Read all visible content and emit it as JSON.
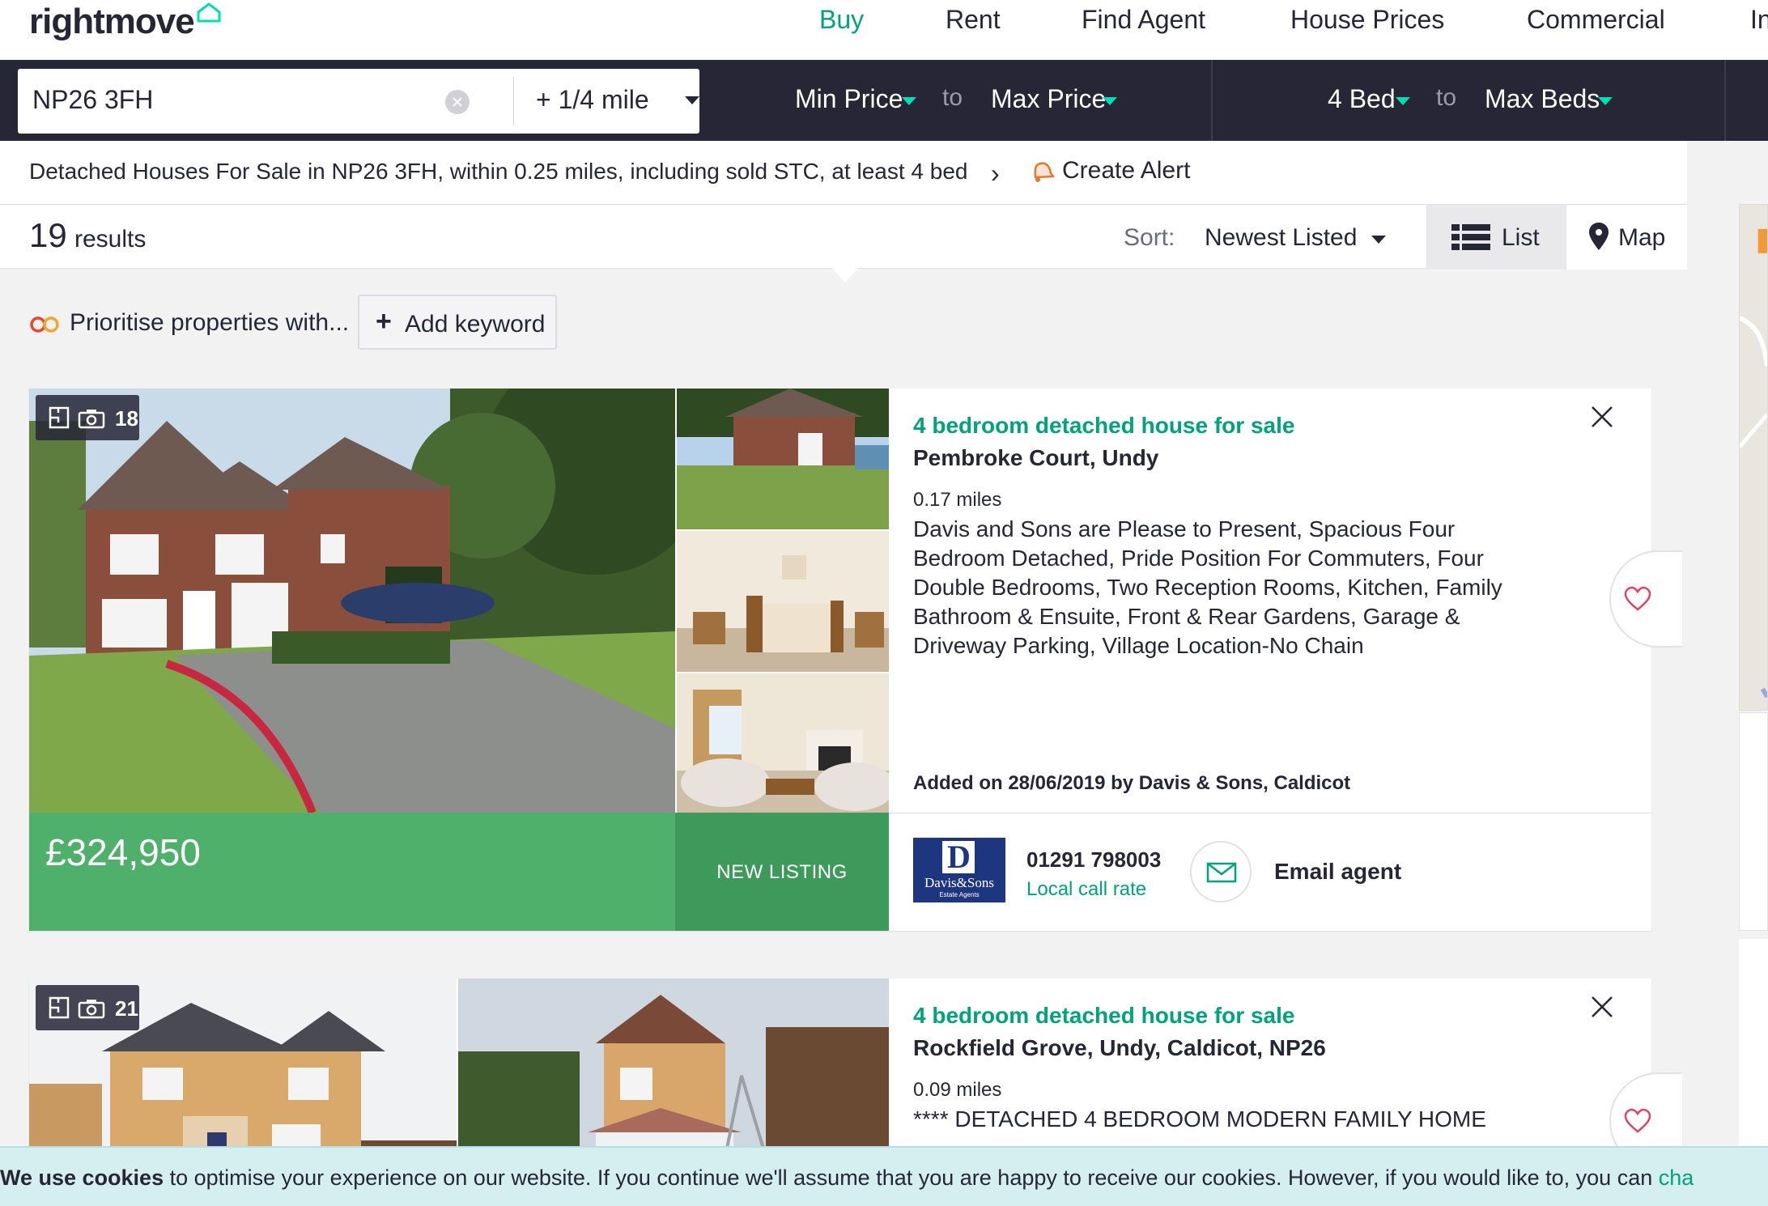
{
  "brand": {
    "logo_text": "rightmove"
  },
  "nav": [
    "Buy",
    "Rent",
    "Find Agent",
    "House Prices",
    "Commercial",
    "In"
  ],
  "search": {
    "location": "NP26 3FH",
    "radius": "+ 1/4 mile",
    "min_price": "Min Price",
    "max_price": "Max Price",
    "min_beds": "4 Bed",
    "max_beds": "Max Beds",
    "to": "to"
  },
  "breadcrumb": {
    "text": "Detached Houses For Sale in NP26 3FH, within 0.25 miles, including sold STC, at least 4 bed",
    "chevron": "›",
    "create_alert": "Create Alert"
  },
  "results": {
    "count": "19",
    "label": "results",
    "sort_label": "Sort:",
    "sort_value": "Newest Listed",
    "list_label": "List",
    "map_label": "Map"
  },
  "keywords": {
    "prioritise": "Prioritise properties with...",
    "add_keyword": "Add keyword"
  },
  "listings": [
    {
      "media_count": "18",
      "title": "4 bedroom detached house for sale",
      "address": "Pembroke Court, Undy",
      "distance": "0.17 miles",
      "summary": "Davis and Sons are Please to Present, Spacious Four Bedroom Detached, Pride Position For Commuters, Four Double Bedrooms, Two Reception Rooms, Kitchen, Family Bathroom & Ensuite, Front & Rear Gardens, Garage & Driveway Parking, Village Location-No Chain",
      "added": "Added on 28/06/2019 by Davis & Sons, Caldicot",
      "price": "£324,950",
      "tag": "NEW LISTING",
      "agent_logo_name": "Davis&Sons",
      "agent_logo_sub": "Estate Agents",
      "phone": "01291 798003",
      "phone_note": "Local call rate",
      "email_label": "Email agent"
    },
    {
      "media_count": "21",
      "title": "4 bedroom detached house for sale",
      "address": "Rockfield Grove, Undy, Caldicot, NP26",
      "distance": "0.09 miles",
      "summary": "**** DETACHED 4 BEDROOM MODERN FAMILY HOME"
    }
  ],
  "cookie": {
    "bold": "We use cookies",
    "text": " to optimise your experience on our website. If you continue we'll assume that you are happy to receive our cookies. However, if you would like to, you can ",
    "link": "cha"
  },
  "colors": {
    "navy": "#262637",
    "accent": "#00deb6",
    "green_text": "#00a37b",
    "price_bar": "#4fb06b",
    "new_listing_bar": "#3d9a5a",
    "agent_logo": "#1e3580",
    "cookie_bg": "#d5eef0"
  },
  "icons": [
    "home-roof-icon",
    "clear-icon",
    "caret-down-icon",
    "chevron-right-icon",
    "bell-icon",
    "list-icon",
    "map-pin-icon",
    "prioritise-icon",
    "plus-icon",
    "floorplan-icon",
    "camera-icon",
    "close-icon",
    "heart-icon",
    "envelope-icon"
  ]
}
